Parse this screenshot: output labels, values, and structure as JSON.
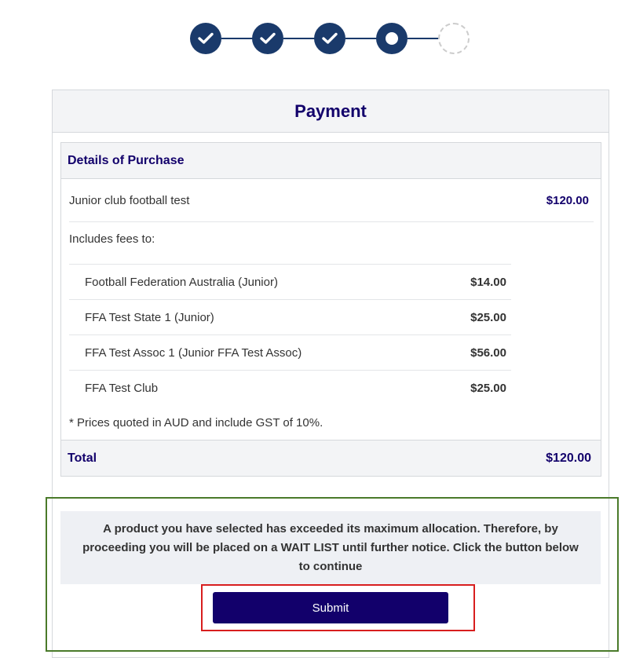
{
  "stepper": {
    "steps": [
      {
        "state": "complete",
        "icon": "check-icon"
      },
      {
        "state": "complete",
        "icon": "check-icon"
      },
      {
        "state": "complete",
        "icon": "check-icon"
      },
      {
        "state": "current"
      },
      {
        "state": "pending"
      }
    ],
    "color": "#1a3a6b"
  },
  "card": {
    "title": "Payment",
    "details_heading": "Details of Purchase",
    "product": {
      "name": "Junior club football test",
      "price": "$120.00"
    },
    "fees_label": "Includes fees to:",
    "fees": [
      {
        "name": "Football Federation Australia (Junior)",
        "amount": "$14.00"
      },
      {
        "name": "FFA Test State 1 (Junior)",
        "amount": "$25.00"
      },
      {
        "name": "FFA Test Assoc 1 (Junior FFA Test Assoc)",
        "amount": "$56.00"
      },
      {
        "name": "FFA Test Club",
        "amount": "$25.00"
      }
    ],
    "note": "* Prices quoted in AUD and include GST of 10%.",
    "total_label": "Total",
    "total_value": "$120.00"
  },
  "waitlist": {
    "message": "A product you have selected has exceeded its maximum allocation. Therefore, by proceeding you will be placed on a WAIT LIST until further notice. Click the button below to continue",
    "submit_label": "Submit"
  },
  "colors": {
    "brand": "#12006b",
    "highlight_green": "#4a7a2a",
    "highlight_red": "#d81e1e"
  }
}
